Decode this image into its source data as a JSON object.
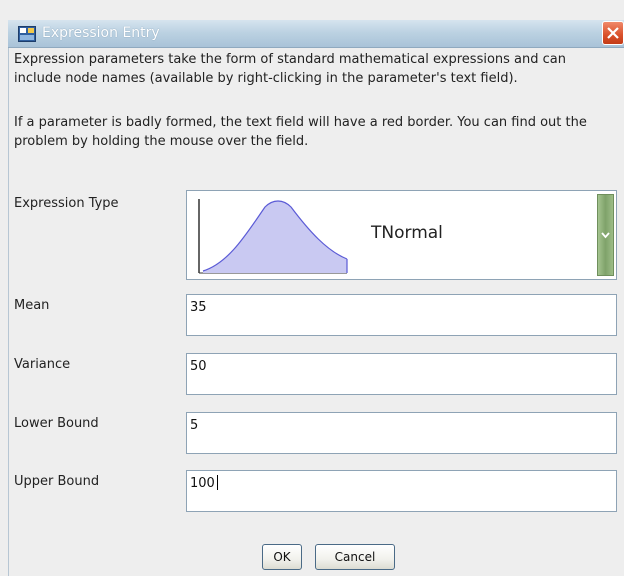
{
  "window": {
    "title": "Expression Entry"
  },
  "description": {
    "paragraph1": "Expression parameters take the form of standard mathematical expressions and can include node names (available by right-clicking in the parameter's text field).",
    "paragraph2": "If a parameter is badly formed, the text field will have a red border. You can find out the problem by holding the mouse over the field."
  },
  "expression_type": {
    "label": "Expression Type",
    "selected": "TNormal",
    "icon": "tnormal-distribution-curve"
  },
  "fields": [
    {
      "label": "Mean",
      "value": "35"
    },
    {
      "label": "Variance",
      "value": "50"
    },
    {
      "label": "Lower Bound",
      "value": "5"
    },
    {
      "label": "Upper Bound",
      "value": "100"
    }
  ],
  "buttons": {
    "ok": "OK",
    "cancel": "Cancel"
  },
  "colors": {
    "title_bar": "#bcd2e2",
    "close_button": "#d9502a",
    "curve_fill": "#c9c9f2",
    "curve_stroke": "#5b5bd6",
    "combo_arrow": "#7fa26a"
  }
}
